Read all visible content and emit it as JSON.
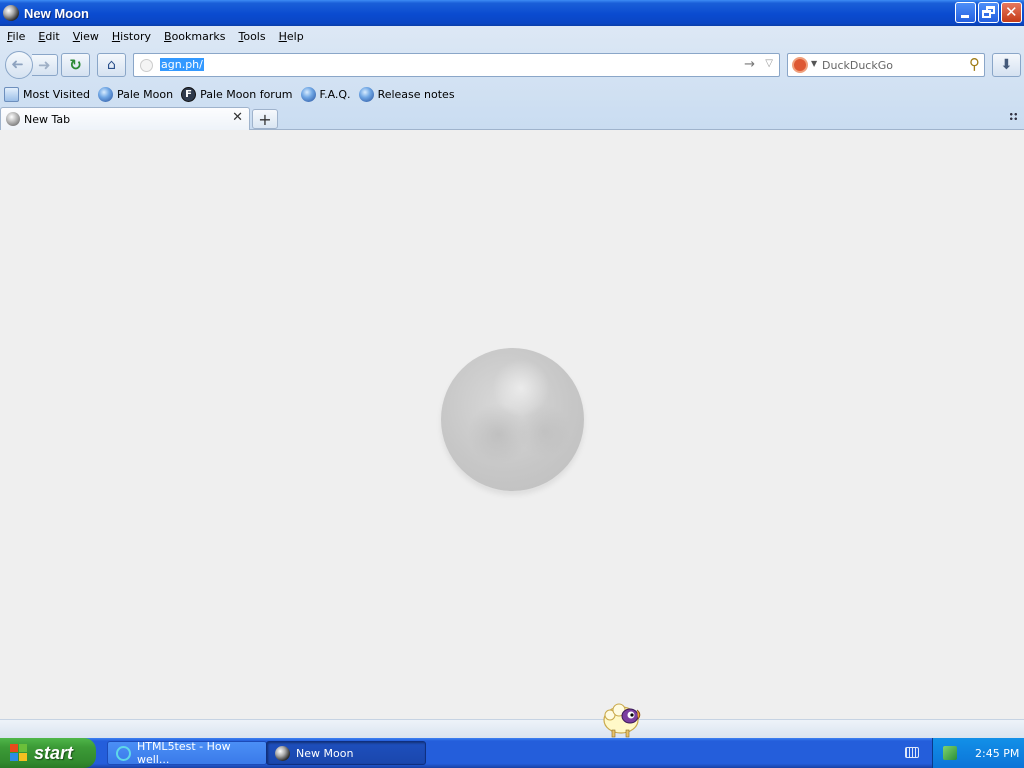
{
  "window": {
    "title": "New Moon"
  },
  "menu": [
    {
      "label": "File",
      "ul": "F",
      "rest": "ile"
    },
    {
      "label": "Edit",
      "ul": "E",
      "rest": "dit"
    },
    {
      "label": "View",
      "ul": "V",
      "rest": "iew"
    },
    {
      "label": "History",
      "ul": "H",
      "rest": "istory"
    },
    {
      "label": "Bookmarks",
      "ul": "B",
      "rest": "ookmarks"
    },
    {
      "label": "Tools",
      "ul": "T",
      "rest": "ools"
    },
    {
      "label": "Help",
      "ul": "H",
      "rest": "elp"
    }
  ],
  "address_bar": {
    "value": "agn.ph/"
  },
  "search_bar": {
    "placeholder": "DuckDuckGo",
    "engine_icon": "duckduckgo-icon"
  },
  "bookmarks": [
    {
      "label": "Most Visited",
      "icon": "most-visited-icon"
    },
    {
      "label": "Pale Moon",
      "icon": "pale-moon-icon"
    },
    {
      "label": "Pale Moon forum",
      "icon": "forum-icon"
    },
    {
      "label": "F.A.Q.",
      "icon": "pale-moon-icon"
    },
    {
      "label": "Release notes",
      "icon": "pale-moon-icon"
    }
  ],
  "tabs": [
    {
      "label": "New Tab",
      "active": true
    }
  ],
  "taskbar": {
    "start_label": "start",
    "tasks": [
      {
        "label": "HTML5test - How well...",
        "active": false
      },
      {
        "label": "New Moon",
        "active": true
      }
    ],
    "clock": "2:45 PM"
  },
  "colors": {
    "taskbar_blue": "#245edb",
    "start_green": "#3c9b37",
    "content_bg": "#efefef",
    "selection_blue": "#3399ff"
  }
}
